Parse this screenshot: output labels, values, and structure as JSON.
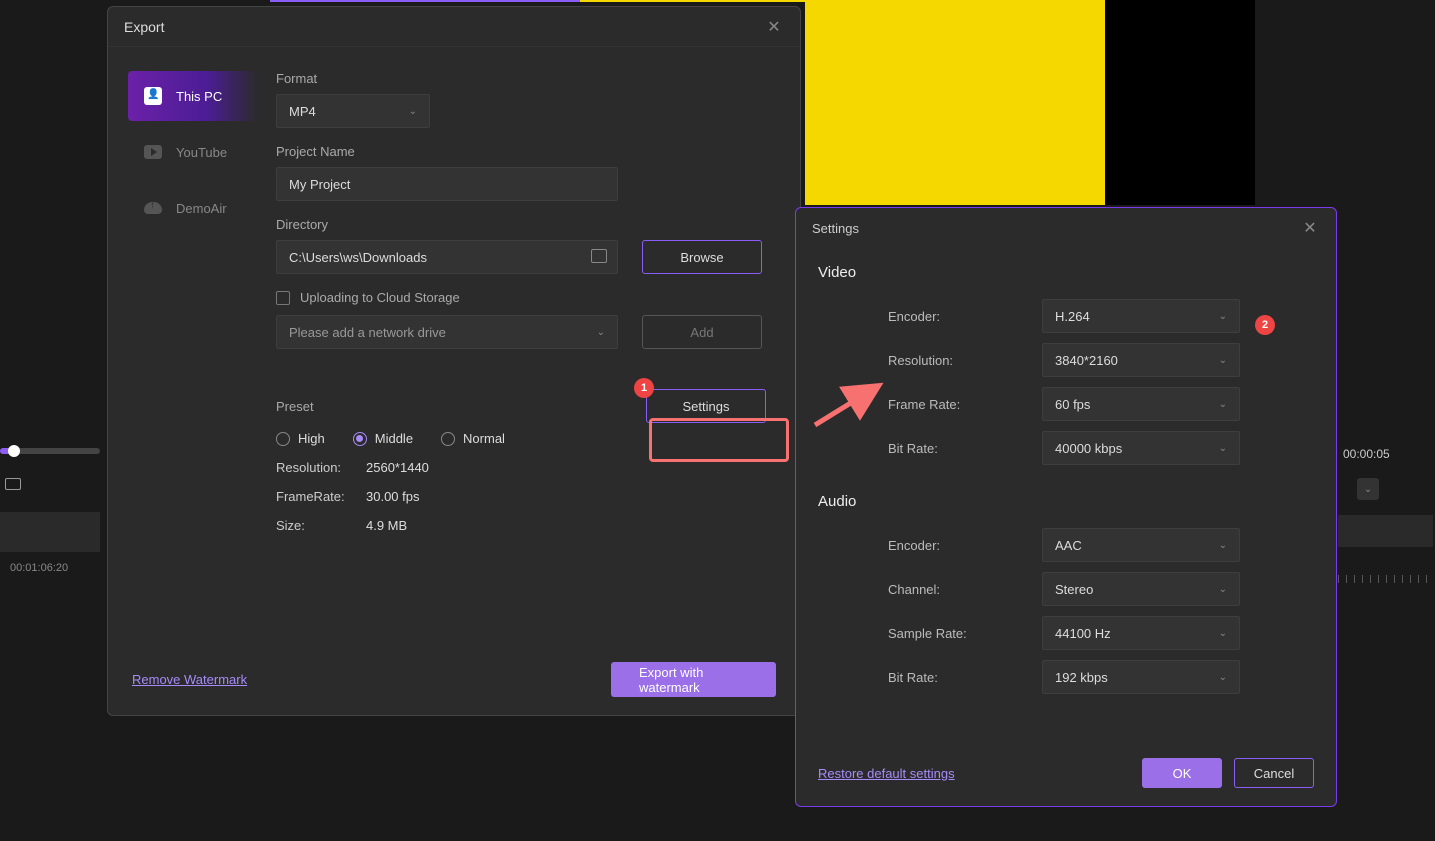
{
  "export": {
    "title": "Export",
    "sidebar": {
      "this_pc": "This PC",
      "youtube": "YouTube",
      "demoair": "DemoAir"
    },
    "format_label": "Format",
    "format_value": "MP4",
    "project_name_label": "Project Name",
    "project_name_value": "My Project",
    "directory_label": "Directory",
    "directory_value": "C:\\Users\\ws\\Downloads",
    "browse": "Browse",
    "upload_cloud": "Uploading to Cloud Storage",
    "network_placeholder": "Please add a network drive",
    "add": "Add",
    "preset_label": "Preset",
    "settings_btn": "Settings",
    "preset_high": "High",
    "preset_middle": "Middle",
    "preset_normal": "Normal",
    "resolution_label": "Resolution:",
    "resolution_value": "2560*1440",
    "framerate_label": "FrameRate:",
    "framerate_value": "30.00 fps",
    "size_label": "Size:",
    "size_value": "4.9 MB",
    "remove_watermark": "Remove Watermark",
    "export_watermark": "Export with watermark"
  },
  "settings": {
    "title": "Settings",
    "video_section": "Video",
    "audio_section": "Audio",
    "video": {
      "encoder_label": "Encoder:",
      "encoder_value": "H.264",
      "resolution_label": "Resolution:",
      "resolution_value": "3840*2160",
      "framerate_label": "Frame Rate:",
      "framerate_value": "60 fps",
      "bitrate_label": "Bit Rate:",
      "bitrate_value": "40000 kbps"
    },
    "audio": {
      "encoder_label": "Encoder:",
      "encoder_value": "AAC",
      "channel_label": "Channel:",
      "channel_value": "Stereo",
      "samplerate_label": "Sample Rate:",
      "samplerate_value": "44100 Hz",
      "bitrate_label": "Bit Rate:",
      "bitrate_value": "192 kbps"
    },
    "restore": "Restore default settings",
    "ok": "OK",
    "cancel": "Cancel"
  },
  "timeline": {
    "left_time": "00:01:06:20",
    "right_time": "00:00:05"
  },
  "annotations": {
    "b1": "1",
    "b2": "2"
  }
}
